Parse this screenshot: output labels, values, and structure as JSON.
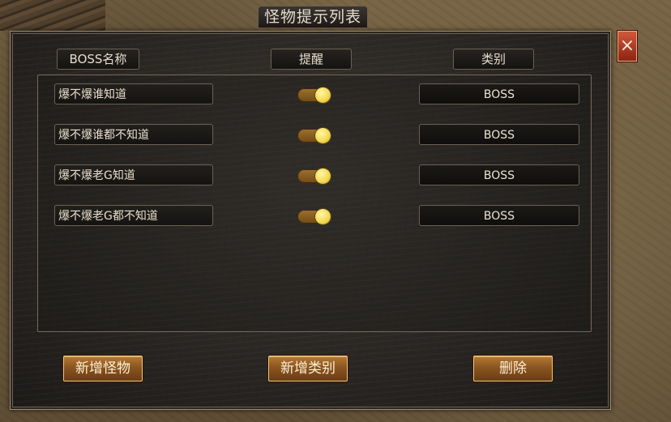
{
  "window": {
    "title": "怪物提示列表",
    "close_label": "×"
  },
  "columns": {
    "name": "BOSS名称",
    "alert": "提醒",
    "type": "类别"
  },
  "rows": [
    {
      "name": "爆不爆谁知道",
      "alert_on": true,
      "type": "BOSS"
    },
    {
      "name": "爆不爆谁都不知道",
      "alert_on": true,
      "type": "BOSS"
    },
    {
      "name": "爆不爆老G知道",
      "alert_on": true,
      "type": "BOSS"
    },
    {
      "name": "爆不爆老G都不知道",
      "alert_on": true,
      "type": "BOSS"
    }
  ],
  "buttons": {
    "add_monster": "新增怪物",
    "add_category": "新增类别",
    "delete": "删除"
  }
}
